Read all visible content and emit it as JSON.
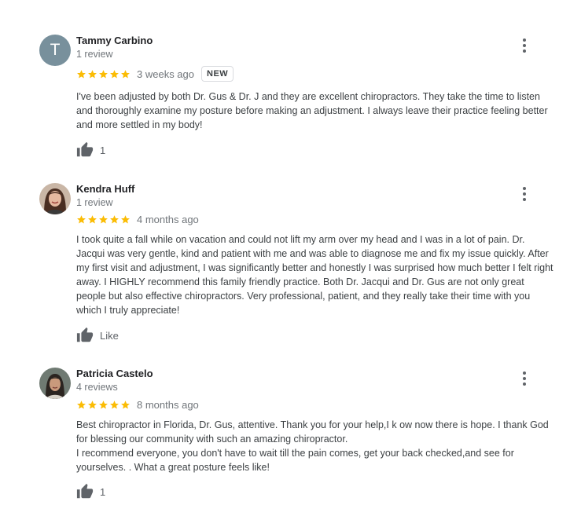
{
  "colors": {
    "star": "#fbbc04",
    "text_primary": "#202124",
    "text_secondary": "#70757a",
    "icon": "#5f6368",
    "initial_avatar_bg": "#78909c"
  },
  "icons": {
    "rating": "star-icon",
    "menu": "more-vert-icon",
    "like": "thumb-up-icon"
  },
  "reviews": [
    {
      "avatar_initial": "T",
      "name": "Tammy Carbino",
      "review_count": "1 review",
      "rating": 5,
      "date": "3 weeks ago",
      "badge": "NEW",
      "text": "I've been adjusted by both Dr. Gus & Dr. J and they are excellent chiropractors. They take the time to listen and thoroughly examine my posture before making an adjustment. I always leave their practice feeling better and more settled in my body!",
      "like_label": "1"
    },
    {
      "name": "Kendra Huff",
      "review_count": "1 review",
      "rating": 5,
      "date": "4 months ago",
      "text": "I took quite a fall while on vacation and could not lift my arm over my head and I was in a lot of pain.  Dr. Jacqui was very gentle, kind and patient with me and was able to diagnose me and fix my issue quickly. After my first visit and adjustment, I was significantly better and honestly I was surprised how much better I felt right away. I HIGHLY recommend this family friendly practice. Both Dr. Jacqui and Dr. Gus are not only great people but also effective chiropractors. Very professional, patient, and they really take their time with you which I truly appreciate!",
      "like_label": "Like"
    },
    {
      "name": "Patricia Castelo",
      "review_count": "4 reviews",
      "rating": 5,
      "date": "8 months ago",
      "text": "Best chiropractor in Florida, Dr. Gus, attentive. Thank you for your help,I k ow now there is hope. I thank God for blessing our community with such an amazing chiropractor.\nI recommend everyone, you don't have to wait till the pain comes, get your back checked,and  see for yourselves. . What a great posture feels like!",
      "like_label": "1"
    }
  ]
}
